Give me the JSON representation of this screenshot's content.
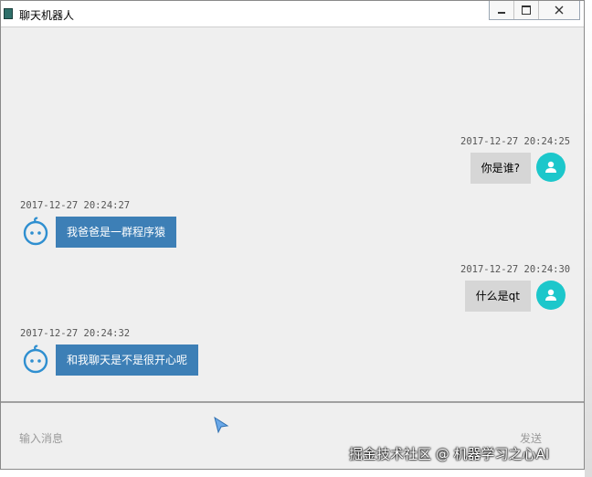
{
  "window": {
    "title": "聊天机器人"
  },
  "messages": [
    {
      "side": "me",
      "time": "2017-12-27 20:24:25",
      "text": "你是谁?"
    },
    {
      "side": "bot",
      "time": "2017-12-27 20:24:27",
      "text": "我爸爸是一群程序猿"
    },
    {
      "side": "me",
      "time": "2017-12-27 20:24:30",
      "text": "什么是qt"
    },
    {
      "side": "bot",
      "time": "2017-12-27 20:24:32",
      "text": "和我聊天是不是很开心呢"
    }
  ],
  "composer": {
    "placeholder": "输入消息",
    "send_label": "发送"
  },
  "watermark": "掘金技术社区 @ 机器学习之心AI",
  "colors": {
    "bot_bubble": "#3d7fb6",
    "me_bubble": "#d6d6d6",
    "me_avatar": "#1cc7cb",
    "bot_icon": "#2f8fd0"
  }
}
